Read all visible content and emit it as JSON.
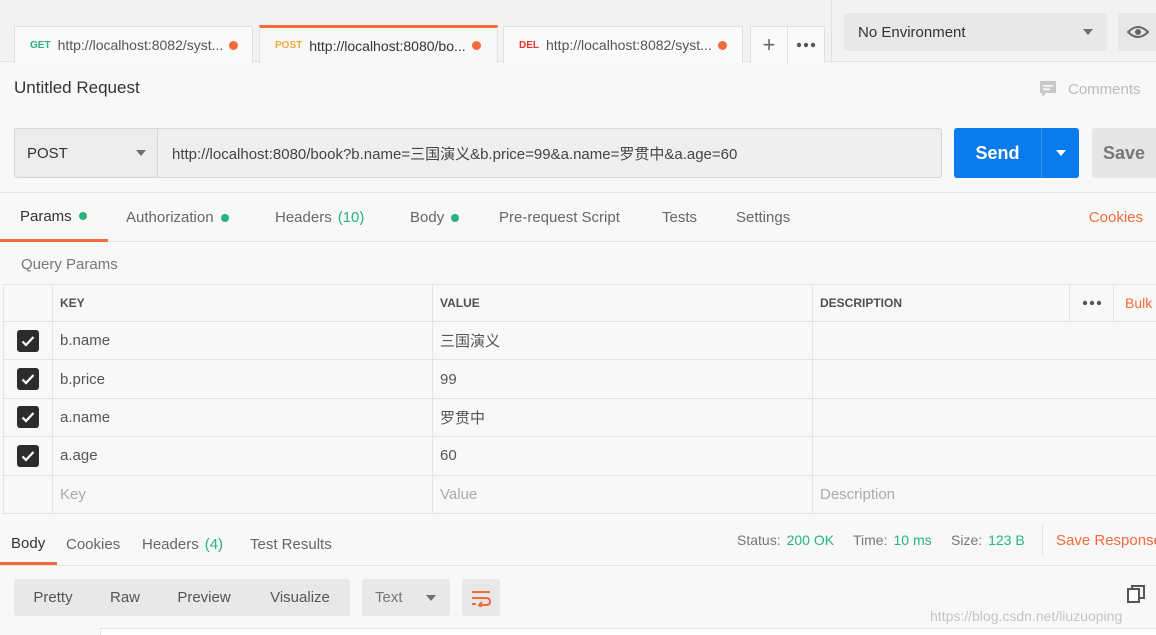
{
  "request_tabs": [
    {
      "method": "GET",
      "method_color": "#26b47f",
      "url": "http://localhost:8082/syst..."
    },
    {
      "method": "POST",
      "method_color": "#f2a93b",
      "url": "http://localhost:8080/bo..."
    },
    {
      "method": "DEL",
      "method_color": "#e5332a",
      "url": "http://localhost:8082/syst..."
    }
  ],
  "environment": {
    "selected": "No Environment"
  },
  "request": {
    "title": "Untitled Request",
    "comments_label": "Comments",
    "method": "POST",
    "url": "http://localhost:8080/book?b.name=三国演义&b.price=99&a.name=罗贯中&a.age=60",
    "send_label": "Send",
    "save_label": "Save"
  },
  "request_subtabs": {
    "params": "Params",
    "authorization": "Authorization",
    "headers": "Headers",
    "headers_count": "(10)",
    "body": "Body",
    "prerequest": "Pre-request Script",
    "tests": "Tests",
    "settings": "Settings",
    "cookies": "Cookies"
  },
  "query_params": {
    "label": "Query Params",
    "columns": {
      "key": "KEY",
      "value": "VALUE",
      "description": "DESCRIPTION"
    },
    "bulk_label": "Bulk",
    "rows": [
      {
        "key": "b.name",
        "value": "三国演义",
        "description": ""
      },
      {
        "key": "b.price",
        "value": "99",
        "description": ""
      },
      {
        "key": "a.name",
        "value": "罗贯中",
        "description": ""
      },
      {
        "key": "a.age",
        "value": "60",
        "description": ""
      }
    ],
    "placeholder": {
      "key": "Key",
      "value": "Value",
      "description": "Description"
    }
  },
  "response": {
    "tabs": {
      "body": "Body",
      "cookies": "Cookies",
      "headers": "Headers",
      "headers_count": "(4)",
      "test_results": "Test Results"
    },
    "status_label": "Status:",
    "status_value": "200 OK",
    "time_label": "Time:",
    "time_value": "10 ms",
    "size_label": "Size:",
    "size_value": "123 B",
    "save_response": "Save Response",
    "view_modes": [
      "Pretty",
      "Raw",
      "Preview",
      "Visualize"
    ],
    "format": "Text"
  },
  "watermark": "https://blog.csdn.net/liuzuoping"
}
